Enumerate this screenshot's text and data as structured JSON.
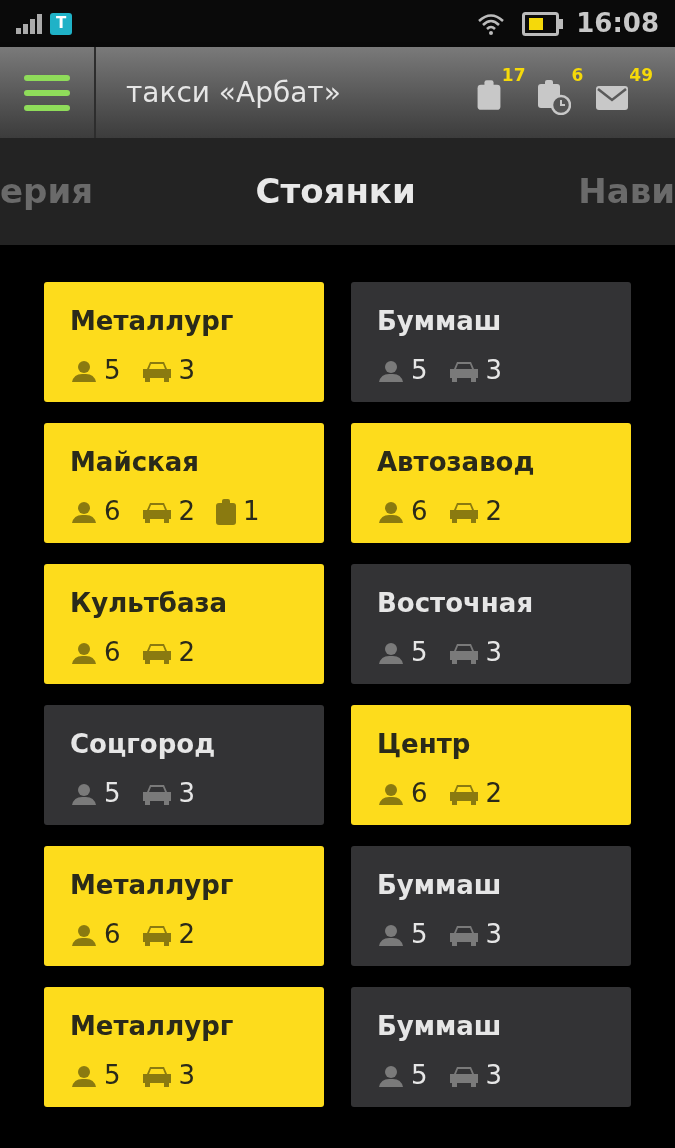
{
  "status_bar": {
    "carrier_badge": "T",
    "time": "16:08"
  },
  "header": {
    "title": "такси «Арбат»",
    "counters": [
      {
        "kind": "orders",
        "count": "17"
      },
      {
        "kind": "scheduled",
        "count": "6"
      },
      {
        "kind": "messages",
        "count": "49"
      }
    ]
  },
  "tabs": [
    {
      "label": "ерия",
      "selected": false
    },
    {
      "label": "Стоянки",
      "selected": true
    },
    {
      "label": "Нави",
      "selected": false
    }
  ],
  "stands": [
    {
      "name": "Металлург",
      "highlighted": true,
      "drivers": "5",
      "cars": "3"
    },
    {
      "name": "Буммаш",
      "highlighted": false,
      "drivers": "5",
      "cars": "3"
    },
    {
      "name": "Майская",
      "highlighted": true,
      "drivers": "6",
      "cars": "2",
      "orders": "1"
    },
    {
      "name": "Автозавод",
      "highlighted": true,
      "drivers": "6",
      "cars": "2"
    },
    {
      "name": "Культбаза",
      "highlighted": true,
      "drivers": "6",
      "cars": "2"
    },
    {
      "name": "Восточная",
      "highlighted": false,
      "drivers": "5",
      "cars": "3"
    },
    {
      "name": "Соцгород",
      "highlighted": false,
      "drivers": "5",
      "cars": "3"
    },
    {
      "name": "Центр",
      "highlighted": true,
      "drivers": "6",
      "cars": "2"
    },
    {
      "name": "Металлург",
      "highlighted": true,
      "drivers": "6",
      "cars": "2"
    },
    {
      "name": "Буммаш",
      "highlighted": false,
      "drivers": "5",
      "cars": "3"
    },
    {
      "name": "Металлург",
      "highlighted": true,
      "drivers": "5",
      "cars": "3"
    },
    {
      "name": "Буммаш",
      "highlighted": false,
      "drivers": "5",
      "cars": "3"
    }
  ]
}
